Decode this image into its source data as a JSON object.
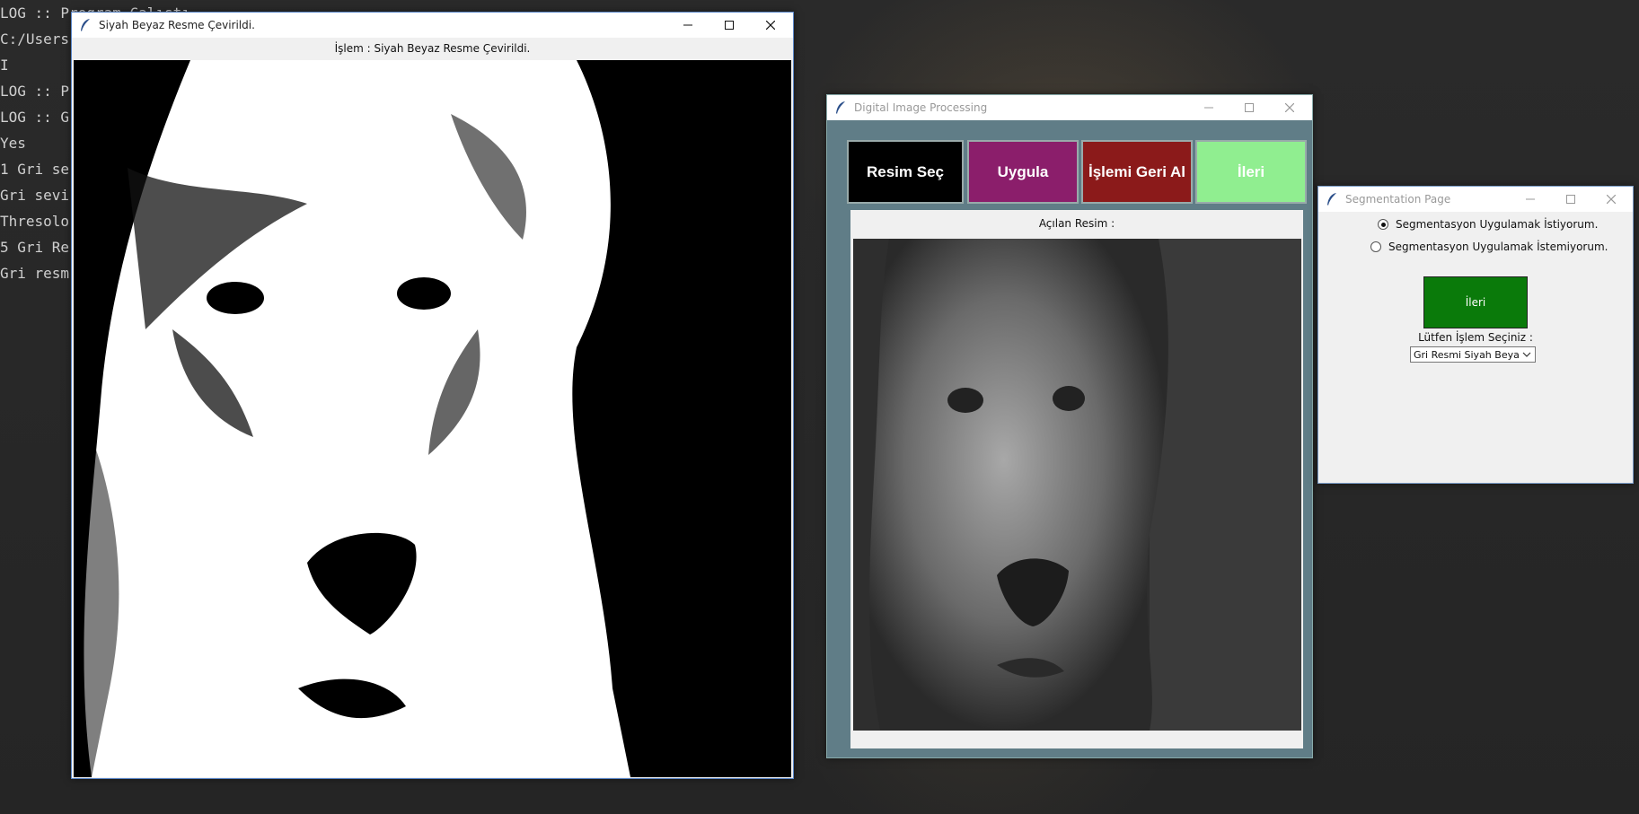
{
  "terminal": {
    "lines": [
      "LOG :: Program Çalıştı",
      "C:/Users",
      "I",
      "LOG :: P",
      "LOG :: G",
      "Yes",
      "1 Gri se",
      "Gri sevi",
      "Thresolo",
      "5 Gri Re",
      "Gri resm"
    ]
  },
  "bw_window": {
    "title": "Siyah Beyaz Resme Çevirildi.",
    "header_label": "İşlem : Siyah Beyaz Resme Çevirildi."
  },
  "main_window": {
    "title": "Digital Image Processing",
    "buttons": {
      "resim_sec": "Resim Seç",
      "uygula": "Uygula",
      "geri_al": "İşlemi Geri Al",
      "ileri": "İleri"
    },
    "button_colors": {
      "resim_sec": "#000000",
      "uygula": "#8b1e6b",
      "geri_al": "#8b1a1a",
      "ileri": "#90ee90"
    },
    "opened_label": "Açılan Resim :"
  },
  "seg_window": {
    "title": "Segmentation Page",
    "radio_yes": "Segmentasyon Uygulamak İstiyorum.",
    "radio_no": "Segmentasyon Uygulamak İstemiyorum.",
    "selected": "yes",
    "next_button": "İleri",
    "choose_label": "Lütfen İşlem Seçiniz :",
    "dropdown_value": "Gri Resmi Siyah Beyaz'a"
  },
  "icons": [
    "feather-icon",
    "minimize-icon",
    "maximize-icon",
    "close-icon",
    "chevron-down-icon"
  ]
}
